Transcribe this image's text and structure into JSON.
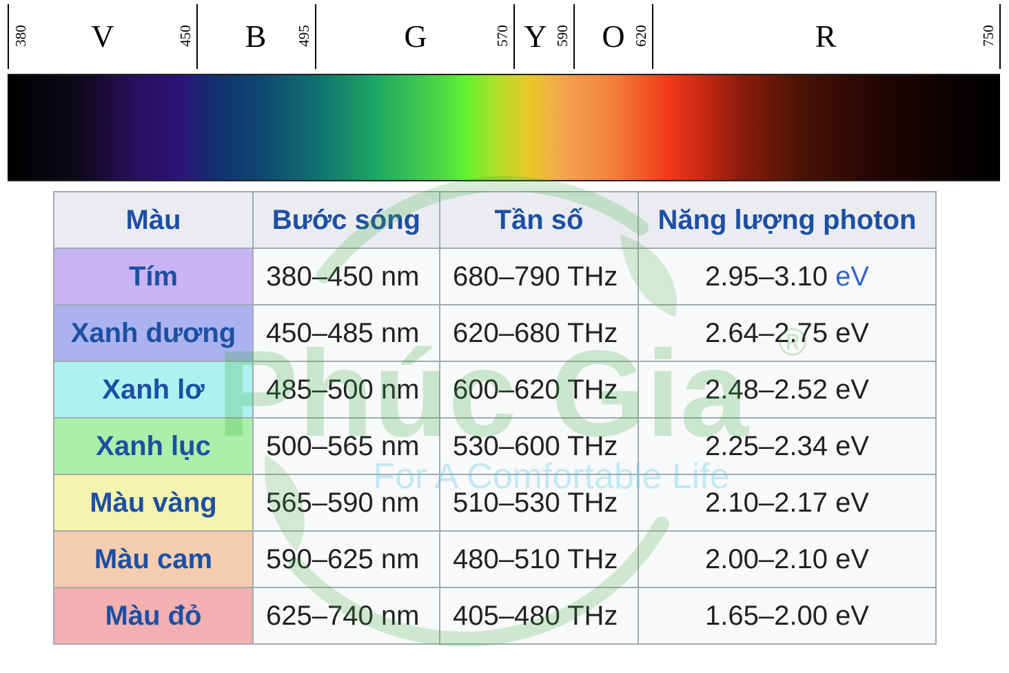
{
  "spectrum": {
    "wavelength_marks": [
      "380",
      "450",
      "495",
      "570",
      "590",
      "620",
      "750"
    ],
    "bands": [
      "V",
      "B",
      "G",
      "Y",
      "O",
      "R"
    ]
  },
  "table": {
    "headers": [
      "Màu",
      "Bước sóng",
      "Tần số",
      "Năng lượng photon"
    ],
    "rows": [
      {
        "name": "Tím",
        "color": "#c8b4f4",
        "wavelength": "380–450 nm",
        "frequency": "680–790 THz",
        "energy_value": "2.95–3.10",
        "energy_unit": "eV"
      },
      {
        "name": "Xanh dương",
        "color": "#aab3f0",
        "wavelength": "450–485 nm",
        "frequency": "620–680 THz",
        "energy_value": "2.64–2.75",
        "energy_unit": "eV"
      },
      {
        "name": "Xanh lơ",
        "color": "#aef2f0",
        "wavelength": "485–500 nm",
        "frequency": "600–620 THz",
        "energy_value": "2.48–2.52",
        "energy_unit": "eV"
      },
      {
        "name": "Xanh lục",
        "color": "#aaf0aa",
        "wavelength": "500–565 nm",
        "frequency": "530–600 THz",
        "energy_value": "2.25–2.34",
        "energy_unit": "eV"
      },
      {
        "name": "Màu vàng",
        "color": "#f4f4b0",
        "wavelength": "565–590 nm",
        "frequency": "510–530 THz",
        "energy_value": "2.10–2.17",
        "energy_unit": "eV"
      },
      {
        "name": "Màu cam",
        "color": "#f4cdb0",
        "wavelength": "590–625 nm",
        "frequency": "480–510 THz",
        "energy_value": "2.00–2.10",
        "energy_unit": "eV"
      },
      {
        "name": "Màu đỏ",
        "color": "#f4b0b0",
        "wavelength": "625–740 nm",
        "frequency": "405–480 THz",
        "energy_value": "1.65–2.00",
        "energy_unit": "eV"
      }
    ]
  },
  "watermark": {
    "brand": "Phúc Gia",
    "registered_mark": "®",
    "tagline": "For A Comfortable Life"
  }
}
